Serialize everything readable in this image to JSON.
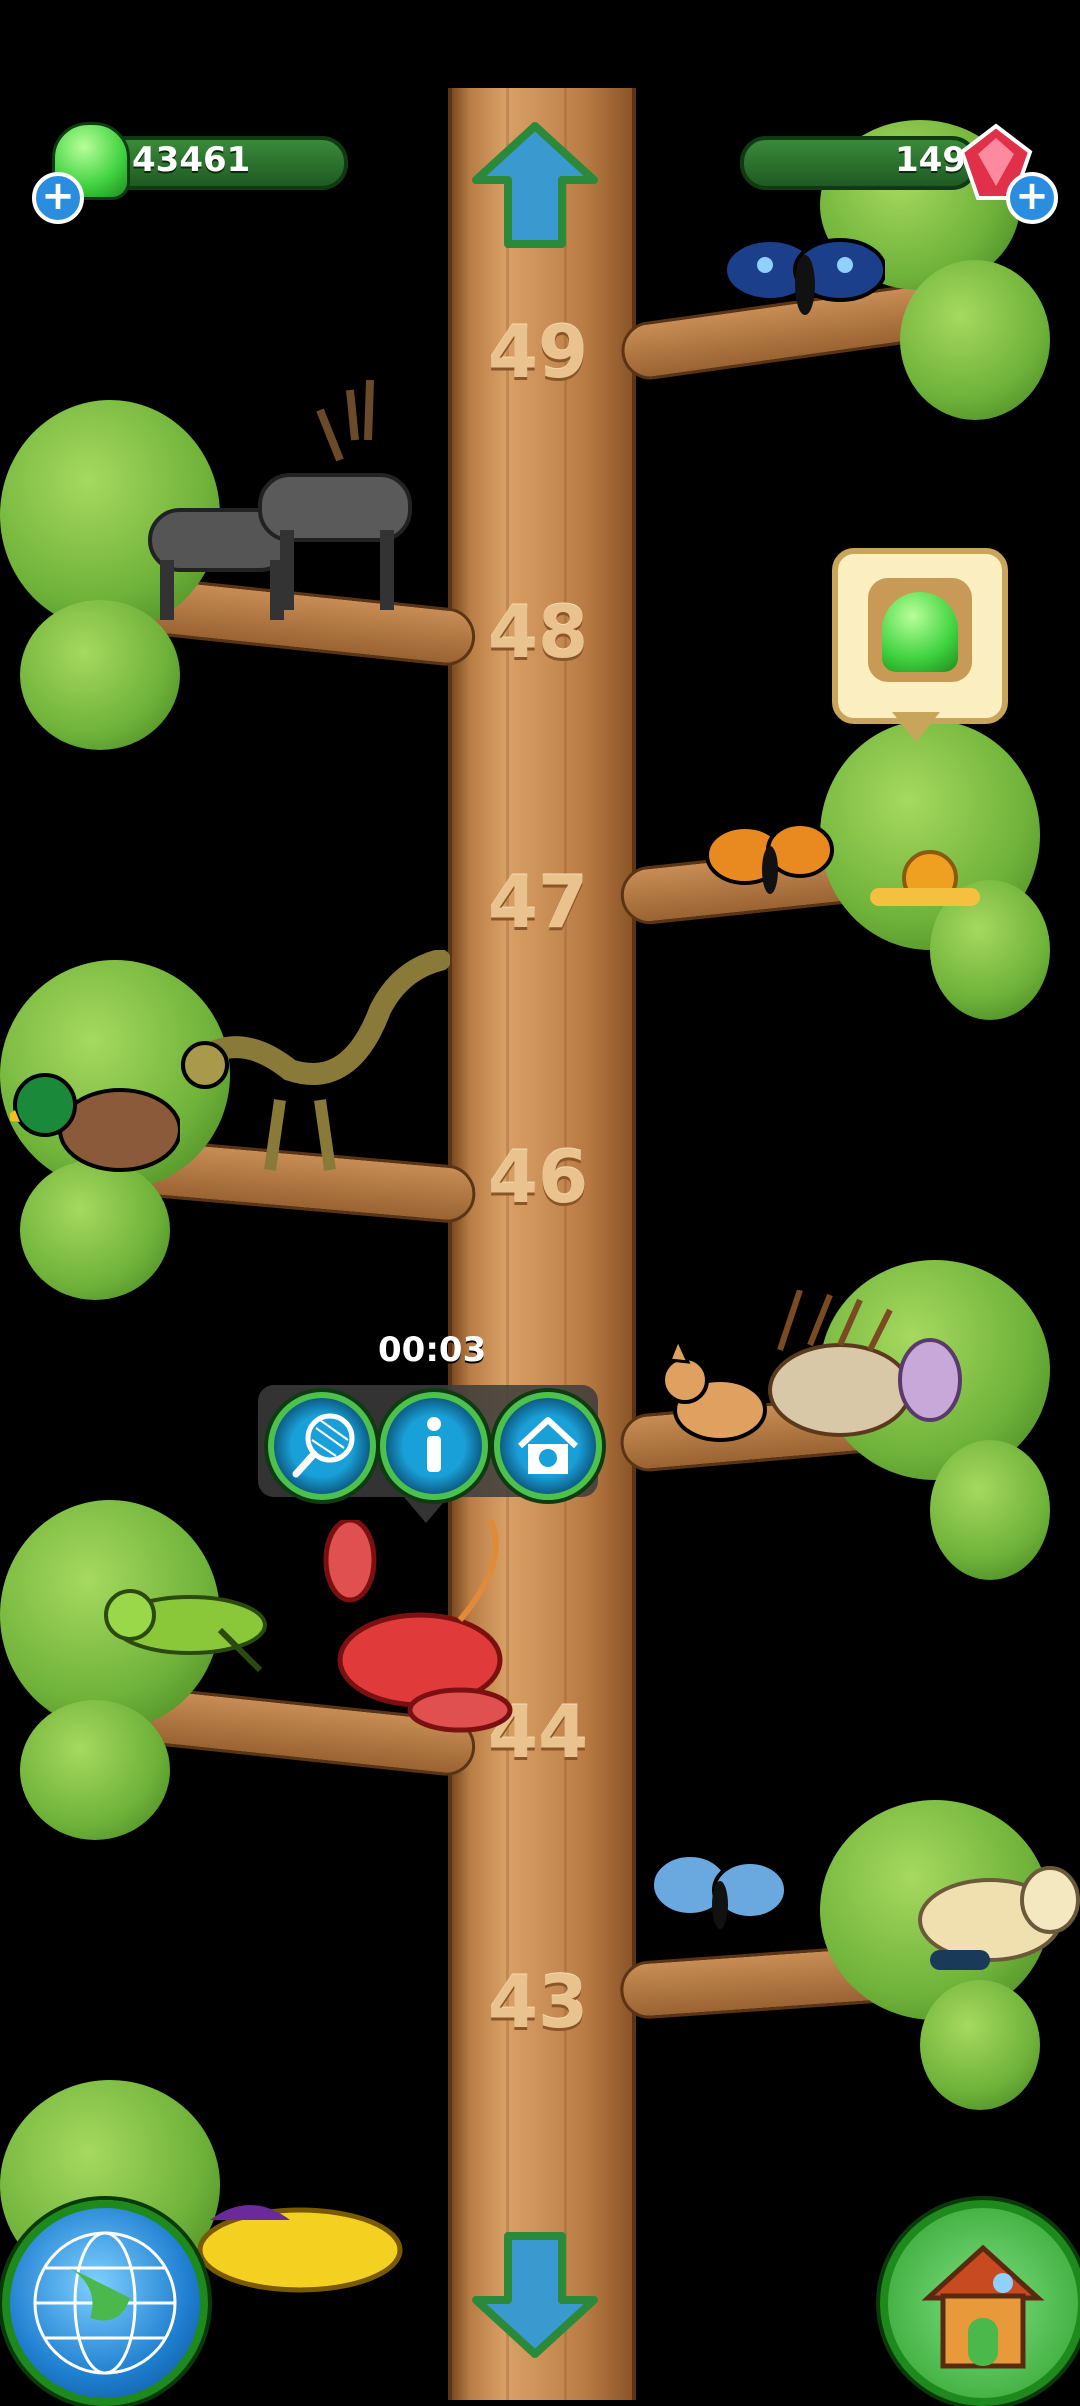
{
  "hud": {
    "jelly_count": "43461",
    "gem_count": "149"
  },
  "levels": [
    "49",
    "48",
    "47",
    "46",
    "44",
    "43"
  ],
  "selected": {
    "timer": "00:03"
  },
  "colors": {
    "jelly": "#3fd23f",
    "gem": "#e0304a",
    "trunk": "#c88d55",
    "leaf": "#6fb23a",
    "button_blue": "#1aa0d8",
    "button_ring": "#4cc24c"
  },
  "icons": {
    "jelly": "green-jelly-icon",
    "gem": "red-gem-icon",
    "net": "net-icon",
    "info": "info-icon",
    "home_pet": "pet-house-icon",
    "globe": "globe-icon",
    "house": "house-icon"
  }
}
